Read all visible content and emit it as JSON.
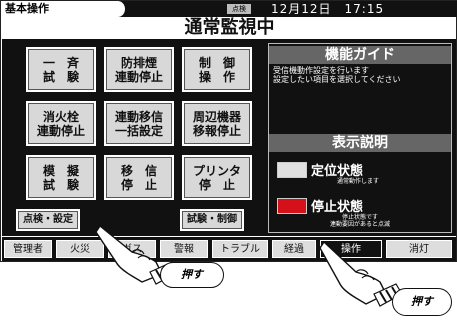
{
  "topbar": {
    "operation_label": "基本操作",
    "status_chip": "点検",
    "datetime": "12月12日　17:15"
  },
  "title": "通常監視中",
  "buttons": [
    {
      "label": "一　斉\n試　験"
    },
    {
      "label": "防排煙\n連動停止"
    },
    {
      "label": "制　御\n操　作"
    },
    {
      "label": "消火栓\n連動停止"
    },
    {
      "label": "連動移信\n一括設定"
    },
    {
      "label": "周辺機器\n移報停止"
    },
    {
      "label": "模　擬\n試　験"
    },
    {
      "label": "移　信\n停　止"
    },
    {
      "label": "プリンタ\n停　止"
    },
    {
      "label": "点検・設定"
    },
    {
      "label": "試験・制御"
    }
  ],
  "guide": {
    "heading": "機能ガイド",
    "text": "受信機動作設定を行います\n設定したい項目を選択してください"
  },
  "legend": {
    "heading": "表示説明",
    "normal_label": "定位状態",
    "normal_note": "通常動作します",
    "stop_label": "停止状態",
    "stop_note": "停止状態です\n連動要因があると点滅",
    "normal_color": "#e0e0e0",
    "stop_color": "#d4111b"
  },
  "tabs": [
    {
      "label": "管理者"
    },
    {
      "label": "火災"
    },
    {
      "label": "ガス"
    },
    {
      "label": "警報"
    },
    {
      "label": "トラブル"
    },
    {
      "label": "経過"
    },
    {
      "label": "操作"
    },
    {
      "label": "消灯"
    }
  ],
  "callouts": {
    "left": "押す",
    "right": "押す"
  }
}
